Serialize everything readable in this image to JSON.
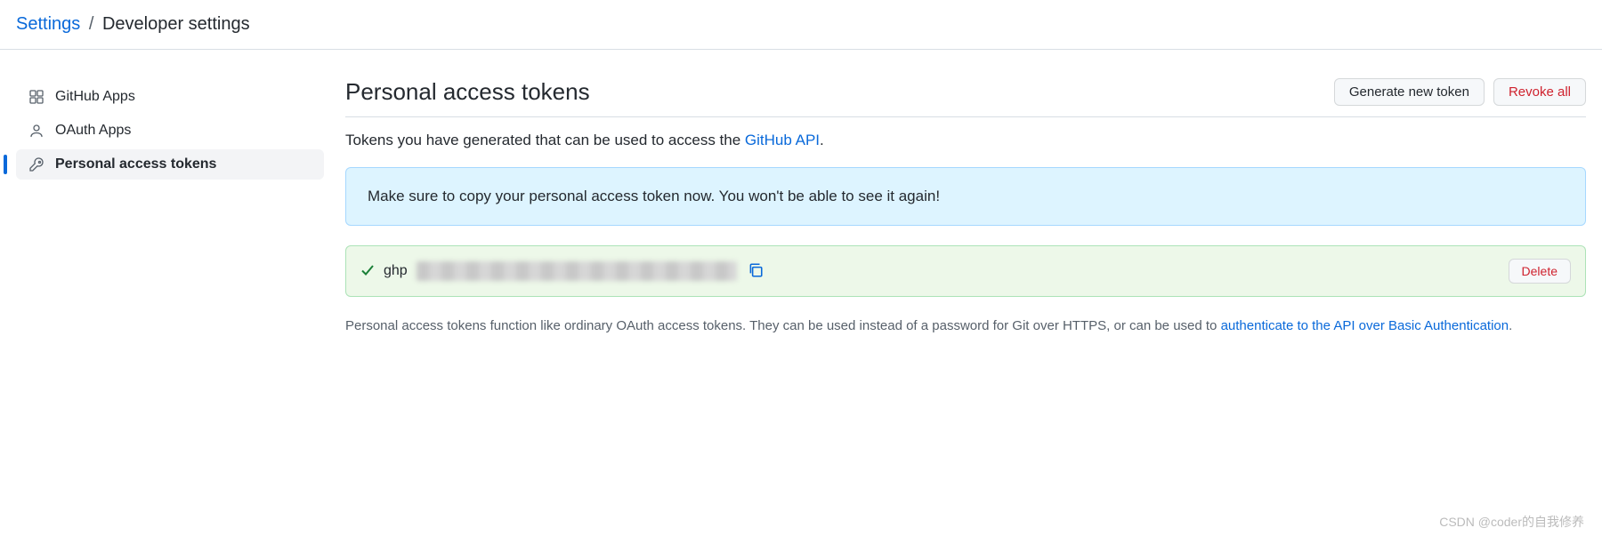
{
  "breadcrumb": {
    "parent": "Settings",
    "separator": "/",
    "current": "Developer settings"
  },
  "sidebar": {
    "items": [
      {
        "label": "GitHub Apps"
      },
      {
        "label": "OAuth Apps"
      },
      {
        "label": "Personal access tokens"
      }
    ]
  },
  "page": {
    "title": "Personal access tokens",
    "generate_button": "Generate new token",
    "revoke_button": "Revoke all"
  },
  "intro": {
    "prefix": "Tokens you have generated that can be used to access the ",
    "link": "GitHub API",
    "suffix": "."
  },
  "notice": {
    "text": "Make sure to copy your personal access token now. You won't be able to see it again!"
  },
  "token": {
    "prefix": "ghp",
    "delete": "Delete"
  },
  "footer": {
    "prefix": "Personal access tokens function like ordinary OAuth access tokens. They can be used instead of a password for Git over HTTPS, or can be used to ",
    "link": "authenticate to the API over Basic Authentication",
    "suffix": "."
  },
  "watermark": "CSDN @coder的自我修养"
}
